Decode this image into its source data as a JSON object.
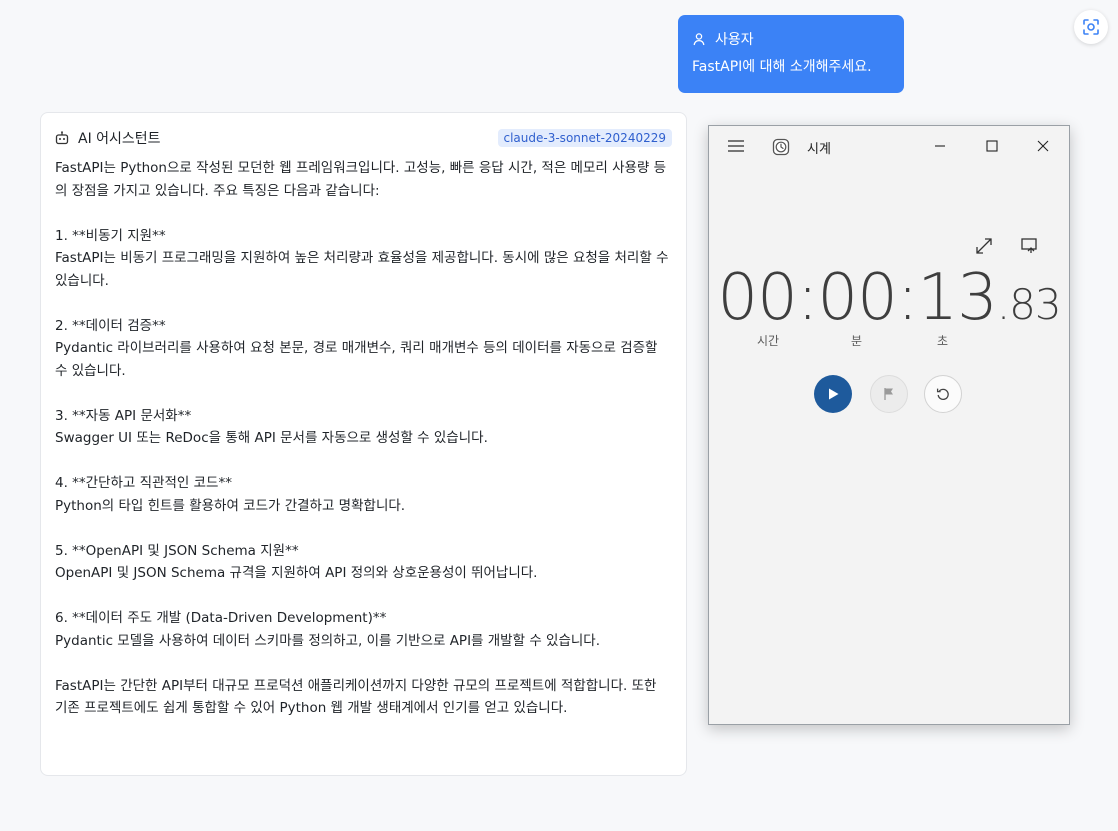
{
  "chat": {
    "user": {
      "label": "사용자",
      "message": "FastAPI에 대해 소개해주세요."
    },
    "assistant": {
      "label": "AI 어시스턴트",
      "model": "claude-3-sonnet-20240229",
      "response": "FastAPI는 Python으로 작성된 모던한 웹 프레임워크입니다. 고성능, 빠른 응답 시간, 적은 메모리 사용량 등의 장점을 가지고 있습니다. 주요 특징은 다음과 같습니다:\n\n1. **비동기 지원**\nFastAPI는 비동기 프로그래밍을 지원하여 높은 처리량과 효율성을 제공합니다. 동시에 많은 요청을 처리할 수 있습니다.\n\n2. **데이터 검증**\nPydantic 라이브러리를 사용하여 요청 본문, 경로 매개변수, 쿼리 매개변수 등의 데이터를 자동으로 검증할 수 있습니다.\n\n3. **자동 API 문서화**\nSwagger UI 또는 ReDoc을 통해 API 문서를 자동으로 생성할 수 있습니다.\n\n4. **간단하고 직관적인 코드**\nPython의 타입 힌트를 활용하여 코드가 간결하고 명확합니다.\n\n5. **OpenAPI 및 JSON Schema 지원**\nOpenAPI 및 JSON Schema 규격을 지원하여 API 정의와 상호운용성이 뛰어납니다.\n\n6. **데이터 주도 개발 (Data-Driven Development)**\nPydantic 모델을 사용하여 데이터 스키마를 정의하고, 이를 기반으로 API를 개발할 수 있습니다.\n\nFastAPI는 간단한 API부터 대규모 프로덕션 애플리케이션까지 다양한 규모의 프로젝트에 적합합니다. 또한 기존 프로젝트에도 쉽게 통합할 수 있어 Python 웹 개발 생태계에서 인기를 얻고 있습니다."
    }
  },
  "clock_app": {
    "title": "시계",
    "stopwatch": {
      "main": "00:00:13",
      "fraction": ".83",
      "units": {
        "hours": "시간",
        "minutes": "분",
        "seconds": "초"
      }
    }
  },
  "icons": {
    "screenshot": "screenshot-icon",
    "user": "person-icon",
    "bot": "robot-icon",
    "menu": "hamburger-icon",
    "app": "clock-app-icon",
    "expand": "expand-icon",
    "keep_on_top": "keep-on-top-icon",
    "start": "play-icon",
    "lap": "flag-icon",
    "reset": "reset-icon"
  },
  "colors": {
    "user_bubble": "#3b82f6",
    "model_tag_bg": "#e3ecfd",
    "model_tag_text": "#2f5fce",
    "start_button": "#1e5a9c"
  }
}
